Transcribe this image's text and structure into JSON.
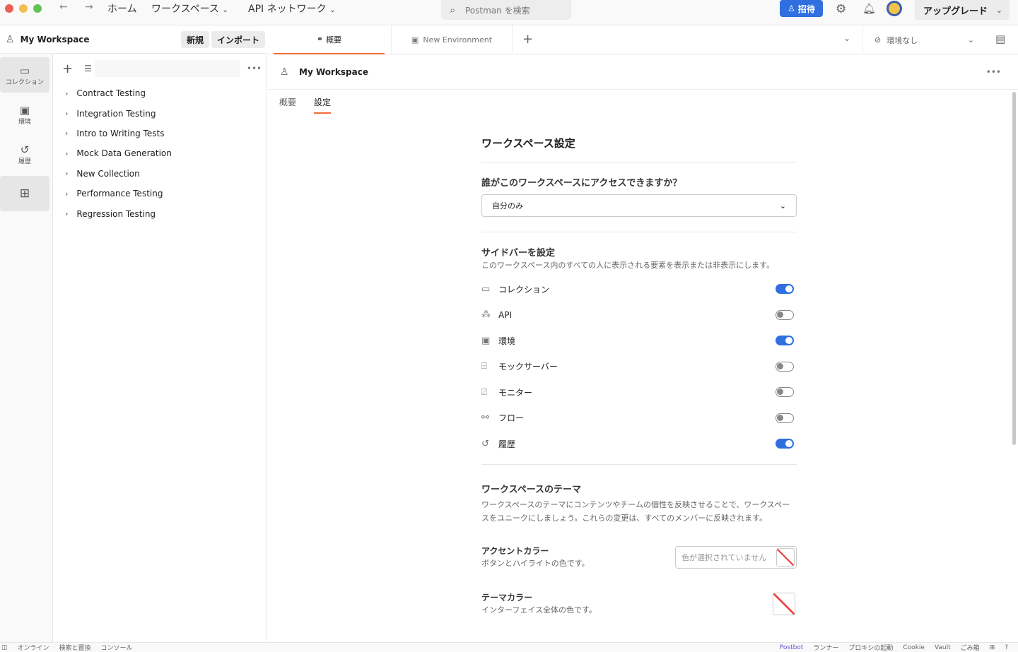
{
  "titlebar": {
    "home": "ホーム",
    "workspaces": "ワークスペース",
    "api_network": "API ネットワーク",
    "search_placeholder": "Postman を検索",
    "invite": "招待",
    "upgrade": "アップグレード"
  },
  "workspace": {
    "name": "My Workspace",
    "new": "新規",
    "import": "インポート"
  },
  "rail": [
    {
      "label": "コレクション"
    },
    {
      "label": "環境"
    },
    {
      "label": "履歴"
    }
  ],
  "collections": [
    "Contract Testing",
    "Integration Testing",
    "Intro to Writing Tests",
    "Mock Data Generation",
    "New Collection",
    "Performance Testing",
    "Regression Testing"
  ],
  "tabs": {
    "overview": "概要",
    "new_env": "New Environment",
    "env_select": "環境なし"
  },
  "main": {
    "title": "My Workspace",
    "subtabs": [
      "概要",
      "設定"
    ]
  },
  "settings": {
    "title": "ワークスペース設定",
    "access_label": "誰がこのワークスペースにアクセスできますか？",
    "access_value": "自分のみ",
    "sidebar_title": "サイドバーを設定",
    "sidebar_desc": "このワークスペース内のすべての人に表示される要素を表示または非表示にします。",
    "items": [
      {
        "label": "コレクション",
        "on": true
      },
      {
        "label": "API",
        "on": false
      },
      {
        "label": "環境",
        "on": true
      },
      {
        "label": "モックサーバー",
        "on": false
      },
      {
        "label": "モニター",
        "on": false
      },
      {
        "label": "フロー",
        "on": false
      },
      {
        "label": "履歴",
        "on": true
      }
    ],
    "theme_title": "ワークスペースのテーマ",
    "theme_desc": "ワークスペースのテーマにコンテンツやチームの個性を反映させることで、ワークスペースをユニークにしましょう。これらの変更は、すべてのメンバーに反映されます。",
    "accent_label": "アクセントカラー",
    "accent_desc": "ボタンとハイライトの色です。",
    "accent_placeholder": "色が選択されていません",
    "theme_color_label": "テーマカラー",
    "theme_color_desc": "インターフェイス全体の色です。"
  },
  "footer": {
    "left": [
      "オンライン",
      "検索と置換",
      "コンソール"
    ],
    "right": [
      "Postbot",
      "ランナー",
      "プロキシの起動",
      "Cookie",
      "Vault",
      "ごみ箱"
    ]
  },
  "colors": {
    "accent": "#2f6fdf",
    "tab_underline": "#f26b3a"
  }
}
